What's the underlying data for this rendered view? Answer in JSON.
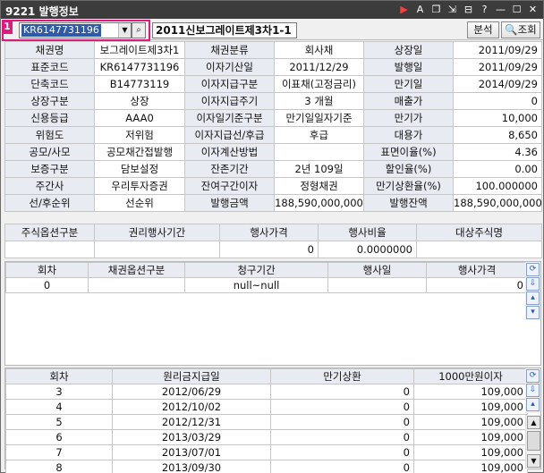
{
  "titlebar": {
    "title": "9221  발행정보",
    "buttons": [
      "▶",
      "A",
      "❐",
      "⇲",
      "⊟",
      "?",
      "—",
      "☐",
      "✕"
    ]
  },
  "toolbar": {
    "badge": "1",
    "code_value": "KR6147731196",
    "bond_name": "2011신보그레이트제3차1-1",
    "analyze_label": "분석",
    "search_label": "조회"
  },
  "info_rows": [
    [
      "채권명",
      "보그레이트제3차1",
      "채권분류",
      "회사채",
      "상장일",
      "2011/09/29"
    ],
    [
      "표준코드",
      "KR6147731196",
      "이자기산일",
      "2011/12/29",
      "발행일",
      "2011/09/29"
    ],
    [
      "단축코드",
      "B14773119",
      "이자지급구분",
      "이표채(고정금리)",
      "만기일",
      "2014/09/29"
    ],
    [
      "상장구분",
      "상장",
      "이자지급주기",
      "3   개월",
      "매출가",
      "0"
    ],
    [
      "신용등급",
      "AAA0",
      "이자일기준구분",
      "만기일일자기준",
      "만기가",
      "10,000"
    ],
    [
      "위험도",
      "저위험",
      "이자지급선/후급",
      "후급",
      "대용가",
      "8,650"
    ],
    [
      "공모/사모",
      "공모채간접발행",
      "이자계산방법",
      "",
      "표면이율(%)",
      "4.36"
    ],
    [
      "보증구분",
      "담보설정",
      "잔존기간",
      "2년 109일",
      "할인율(%)",
      "0.00"
    ],
    [
      "주간사",
      "우리투자증권",
      "잔여구간이자",
      "정형채권",
      "만기상환율(%)",
      "100.000000"
    ],
    [
      "선/후순위",
      "선순위",
      "발행금액",
      "188,590,000,000",
      "발행잔액",
      "188,590,000,000"
    ]
  ],
  "stock_option": {
    "headers": [
      "주식옵션구분",
      "권리행사기간",
      "행사가격",
      "행사비율",
      "대상주식명"
    ],
    "row": [
      "",
      "",
      "0",
      "0.0000000",
      ""
    ]
  },
  "bond_option": {
    "headers": [
      "회차",
      "채권옵션구분",
      "청구기간",
      "행사일",
      "행사가격"
    ],
    "row": [
      "0",
      "",
      "null~null",
      "",
      "0"
    ]
  },
  "payment": {
    "headers": [
      "회차",
      "원리금지급일",
      "만기상환",
      "1000만원이자"
    ],
    "rows": [
      [
        "3",
        "2012/06/29",
        "0",
        "109,000"
      ],
      [
        "4",
        "2012/10/02",
        "0",
        "109,000"
      ],
      [
        "5",
        "2012/12/31",
        "0",
        "109,000"
      ],
      [
        "6",
        "2013/03/29",
        "0",
        "109,000"
      ],
      [
        "7",
        "2013/07/01",
        "0",
        "109,000"
      ],
      [
        "8",
        "2013/09/30",
        "0",
        "109,000"
      ]
    ]
  }
}
